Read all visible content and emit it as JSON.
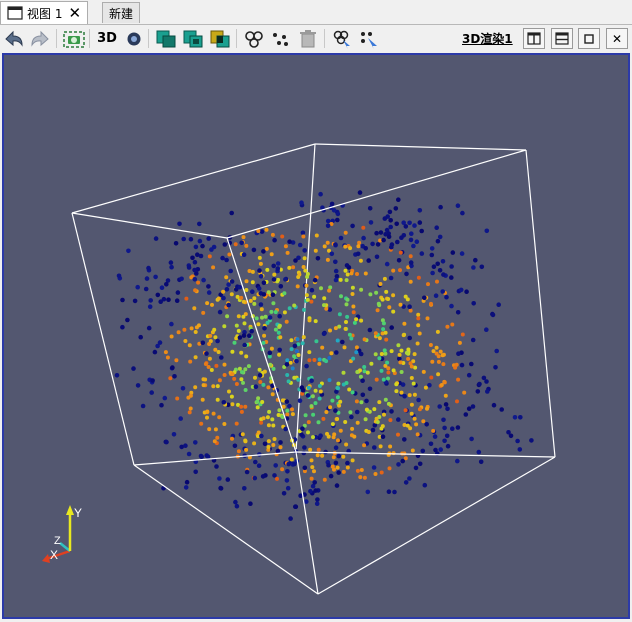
{
  "tabs": [
    {
      "label": "视图 1",
      "close": "✕",
      "active": true
    },
    {
      "label": "新建",
      "active": false
    }
  ],
  "toolbar": {
    "label_3d": "3D",
    "render_view_label": "3D渲染1"
  },
  "window_buttons": {
    "close_glyph": "✕"
  },
  "axes": {
    "x": "X",
    "y": "Y",
    "z": "Z"
  },
  "colors": {
    "background": "#535770",
    "viewport_border": "#2c3aa8",
    "box_outline": "#ffffff",
    "colormap": [
      "#07076e",
      "#1f3cc8",
      "#1ea8c8",
      "#3fd07a",
      "#d8d81e",
      "#f0a018",
      "#e05818"
    ],
    "axis_x": "#e04020",
    "axis_y": "#e8e820",
    "axis_z": "#30c0c0"
  },
  "icons": [
    "undo-camera-icon",
    "redo-camera-icon",
    "capture-screenshot-icon",
    "interaction-mode-icon",
    "select-cells-icon",
    "select-points-icon",
    "select-frustum-icon",
    "select-block-icon",
    "select-points-on-icon",
    "clear-selection-icon",
    "interactive-select-cells-icon",
    "interactive-select-points-icon",
    "split-horizontal-icon",
    "split-vertical-icon",
    "maximize-icon",
    "close-icon"
  ]
}
